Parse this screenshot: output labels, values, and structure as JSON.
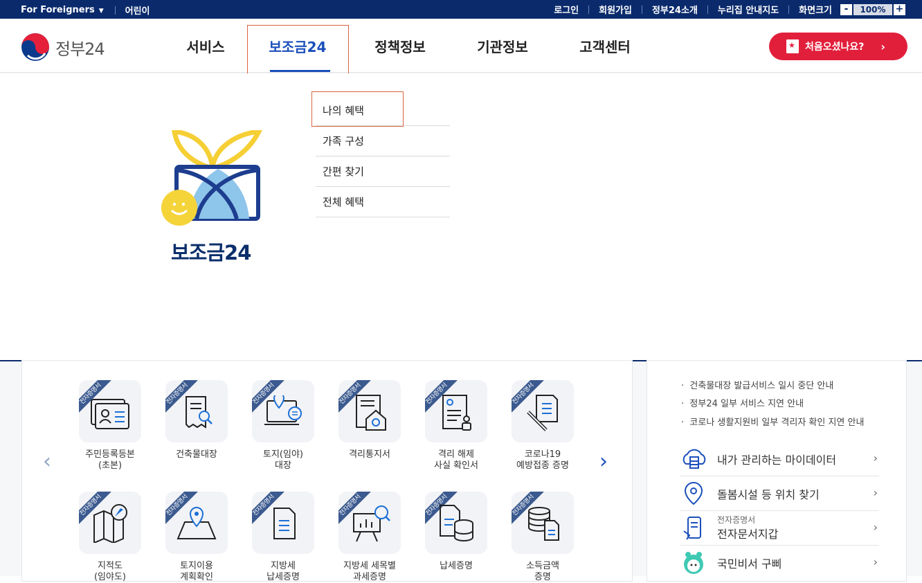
{
  "topbar": {
    "foreigners": "For Foreigners",
    "kids": "어린이",
    "links": [
      "로그인",
      "회원가입",
      "정부24소개",
      "누리집 안내지도",
      "화면크기"
    ],
    "zoom_minus": "-",
    "zoom_value": "100%",
    "zoom_plus": "+"
  },
  "header": {
    "logo_text": "정부24",
    "nav": [
      "서비스",
      "보조금24",
      "정책정보",
      "기관정보",
      "고객센터"
    ],
    "cta": "처음오셨나요?",
    "cta_arrow": "›"
  },
  "mega": {
    "title": "보조금24",
    "submenu": [
      "나의 혜택",
      "가족 구성",
      "간편 찾기",
      "전체 혜택"
    ]
  },
  "services": {
    "badge": "전자증명서",
    "row1": [
      {
        "l1": "주민등록등본",
        "l2": "(초본)"
      },
      {
        "l1": "건축물대장",
        "l2": ""
      },
      {
        "l1": "토지(임야)",
        "l2": "대장"
      },
      {
        "l1": "격리통지서",
        "l2": ""
      },
      {
        "l1": "격리 해제",
        "l2": "사실 확인서"
      },
      {
        "l1": "코로나19",
        "l2": "예방접종 증명"
      }
    ],
    "row2": [
      {
        "l1": "지적도",
        "l2": "(임야도)"
      },
      {
        "l1": "토지이용",
        "l2": "계획확인"
      },
      {
        "l1": "지방세",
        "l2": "납세증명"
      },
      {
        "l1": "지방세 세목별",
        "l2": "과세증명"
      },
      {
        "l1": "납세증명",
        "l2": ""
      },
      {
        "l1": "소득금액",
        "l2": "증명"
      }
    ],
    "prev": "‹",
    "next": "›"
  },
  "notices": [
    "건축물대장 발급서비스 일시 중단 안내",
    "정부24 일부 서비스 지연 안내",
    "코로나 생활지원비 일부 격리자 확인 지연 안내"
  ],
  "quick": [
    {
      "label": "내가 관리하는 마이데이터",
      "sub": ""
    },
    {
      "label": "돌봄시설 등 위치 찾기",
      "sub": ""
    },
    {
      "label": "전자문서지갑",
      "sub": "전자증명서"
    },
    {
      "label": "국민비서 구삐",
      "sub": ""
    }
  ],
  "colors": {
    "navy": "#0a2a6c",
    "accent": "#1b4fbb",
    "cta": "#e21f3b",
    "highlight": "#d8643f"
  }
}
